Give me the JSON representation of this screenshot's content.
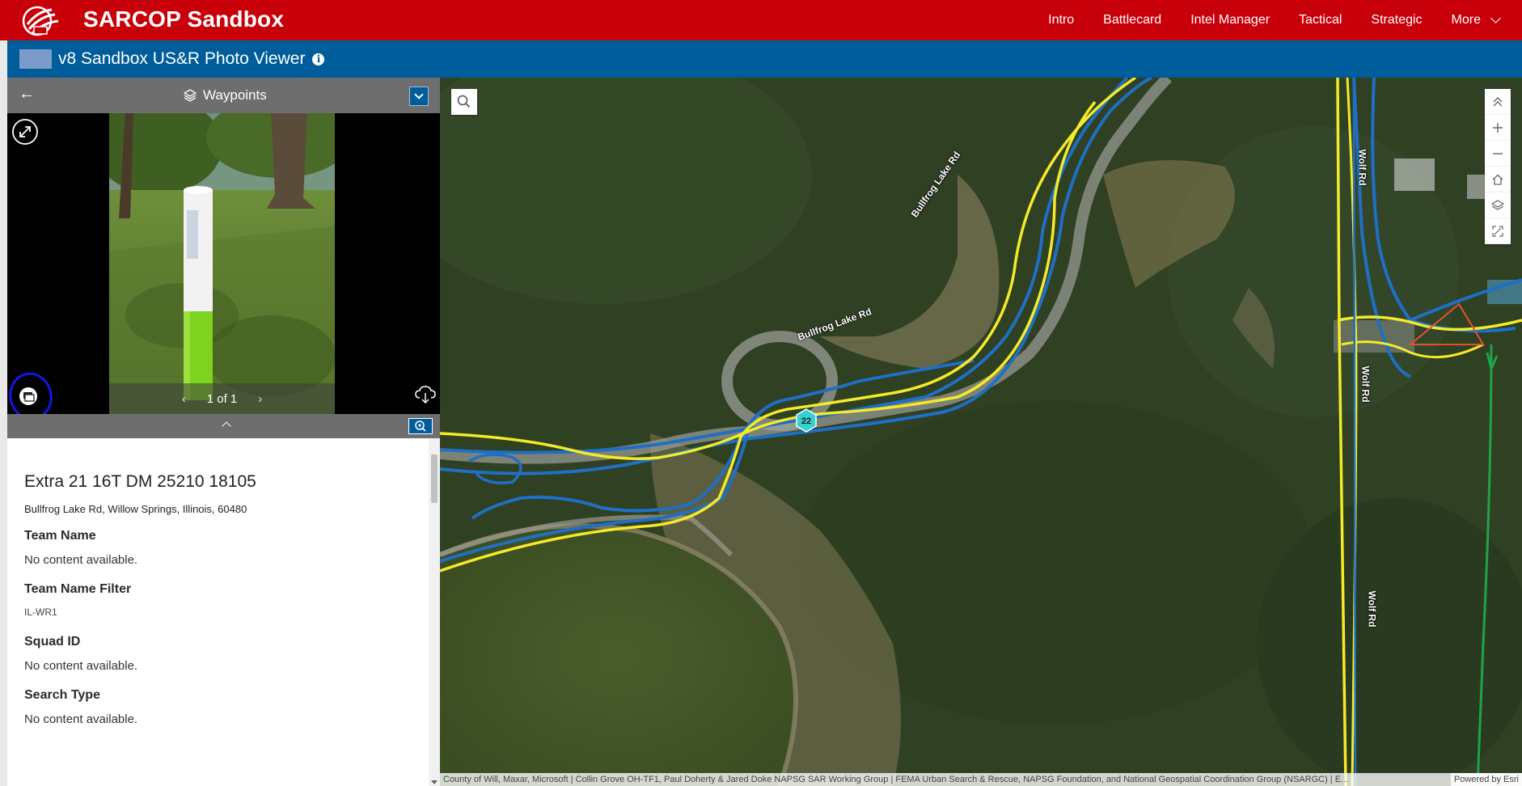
{
  "app": {
    "brand": "SARCOP Sandbox",
    "nav": [
      "Intro",
      "Battlecard",
      "Intel Manager",
      "Tactical",
      "Strategic"
    ],
    "nav_more": "More"
  },
  "subheader": {
    "title": "v8 Sandbox US&R Photo Viewer",
    "info_glyph": "i"
  },
  "panel": {
    "back_glyph": "←",
    "layer_title": "Waypoints",
    "photo_counter": "1 of 1",
    "prev_glyph": "‹",
    "next_glyph": "›"
  },
  "details": {
    "title": "Extra 21 16T DM 25210 18105",
    "address": "Bullfrog Lake Rd, Willow Springs, Illinois, 60480",
    "fields": [
      {
        "label": "Team Name",
        "value": "No content available."
      },
      {
        "label": "Team Name Filter",
        "value": "IL-WR1"
      },
      {
        "label": "Squad ID",
        "value": "No content available."
      },
      {
        "label": "Search Type",
        "value": "No content available."
      }
    ]
  },
  "map": {
    "road_labels": [
      "Bullfrog Lake Rd",
      "Bullfrog Lake Rd",
      "Wolf Rd",
      "Wolf Rd",
      "Wolf Rd"
    ],
    "marker_label": "22",
    "attribution": "County of Will, Maxar, Microsoft | Collin Grove OH-TF1, Paul Doherty & Jared Doke NAPSG SAR Working Group | FEMA Urban Search & Rescue, NAPSG Foundation, and National Geospatial Coordination Group (NSARGC) | E...",
    "powered_by": "Powered by Esri"
  },
  "colors": {
    "topbar": "#c8000a",
    "subheader": "#005d9b",
    "panel_header": "#6e6e6e",
    "track_blue": "#1f6fc4",
    "track_yellow": "#f4ea2a",
    "track_green": "#1fa34a",
    "annotation_circle": "#1515e6"
  },
  "icons": {
    "logo": "sarcop-logo-icon",
    "info": "info-icon",
    "layers": "layers-icon",
    "expand": "expand-icon",
    "attachment": "attachment-icon",
    "cloud": "cloud-download-icon",
    "zoom_to": "zoom-to-icon",
    "search": "search-icon"
  }
}
